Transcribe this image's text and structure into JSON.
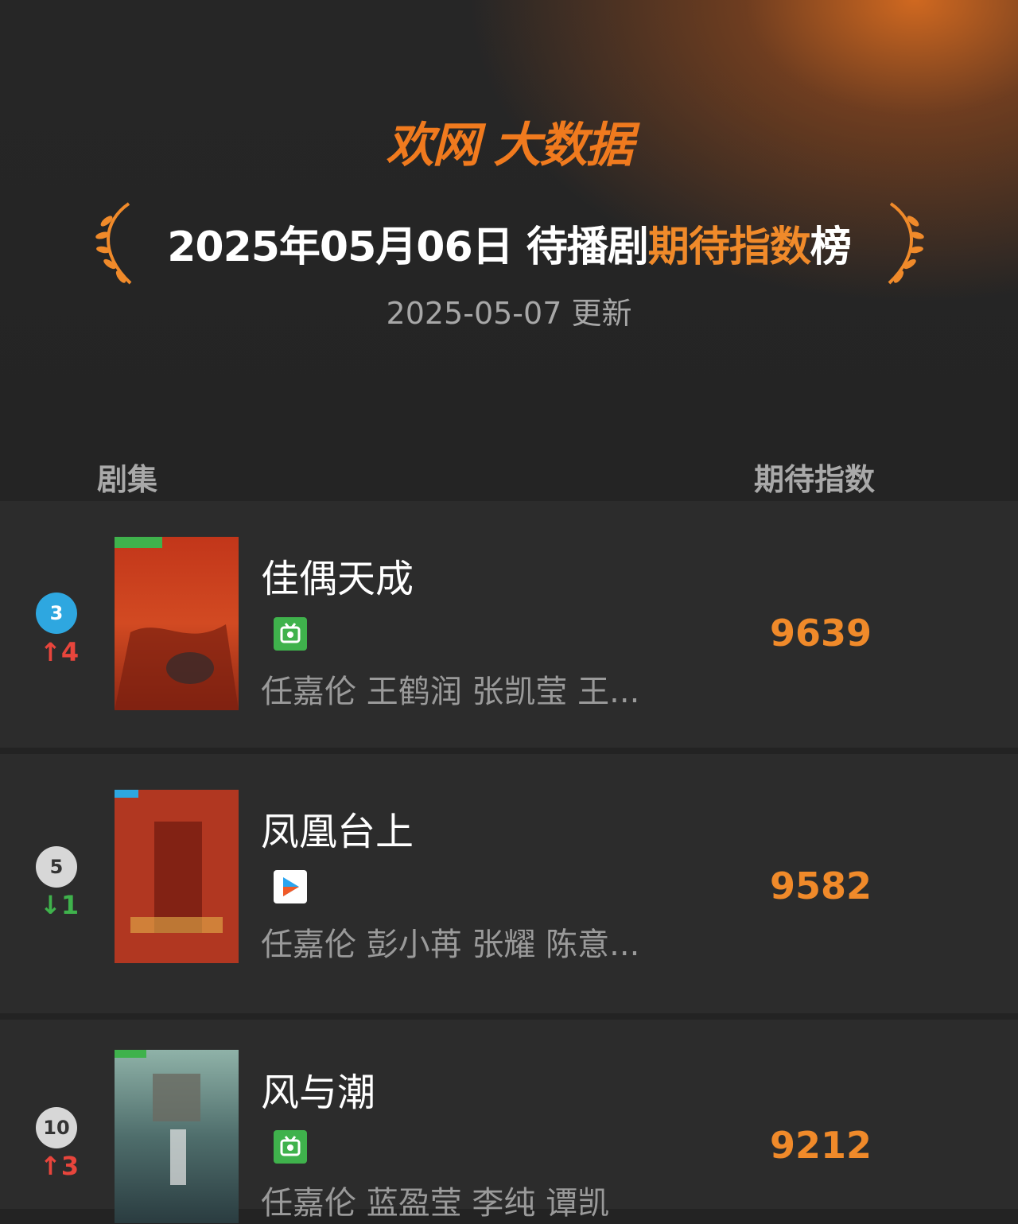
{
  "header": {
    "brand": "欢网 大数据",
    "headline_prefix": "2025年05月06日 待播剧",
    "headline_highlight": "期待指数",
    "headline_suffix": "榜",
    "updated": "2025-05-07 更新"
  },
  "columns": {
    "left": "剧集",
    "right": "期待指数"
  },
  "rows": [
    {
      "rank": "3",
      "rank_color": "#2ea7e0",
      "delta": "↑4",
      "delta_dir": "up",
      "title": "佳偶天成",
      "platform_icon": "iqiyi-icon",
      "cast": "任嘉伦 王鹤润 张凯莹 王...",
      "score": "9639"
    },
    {
      "rank": "5",
      "rank_color": "#d7d7d7",
      "delta": "↓1",
      "delta_dir": "down",
      "title": "凤凰台上",
      "platform_icon": "youku-icon",
      "cast": "任嘉伦 彭小苒 张耀 陈意...",
      "score": "9582"
    },
    {
      "rank": "10",
      "rank_color": "#d7d7d7",
      "delta": "↑3",
      "delta_dir": "up",
      "title": "风与潮",
      "platform_icon": "iqiyi-icon",
      "cast": "任嘉伦 蓝盈莹 李纯 谭凯",
      "score": "9212"
    }
  ],
  "colors": {
    "accent": "#f08a2a",
    "background": "#232323",
    "row_background": "#2c2c2c",
    "up": "#e8453c",
    "down": "#3fb24c"
  }
}
